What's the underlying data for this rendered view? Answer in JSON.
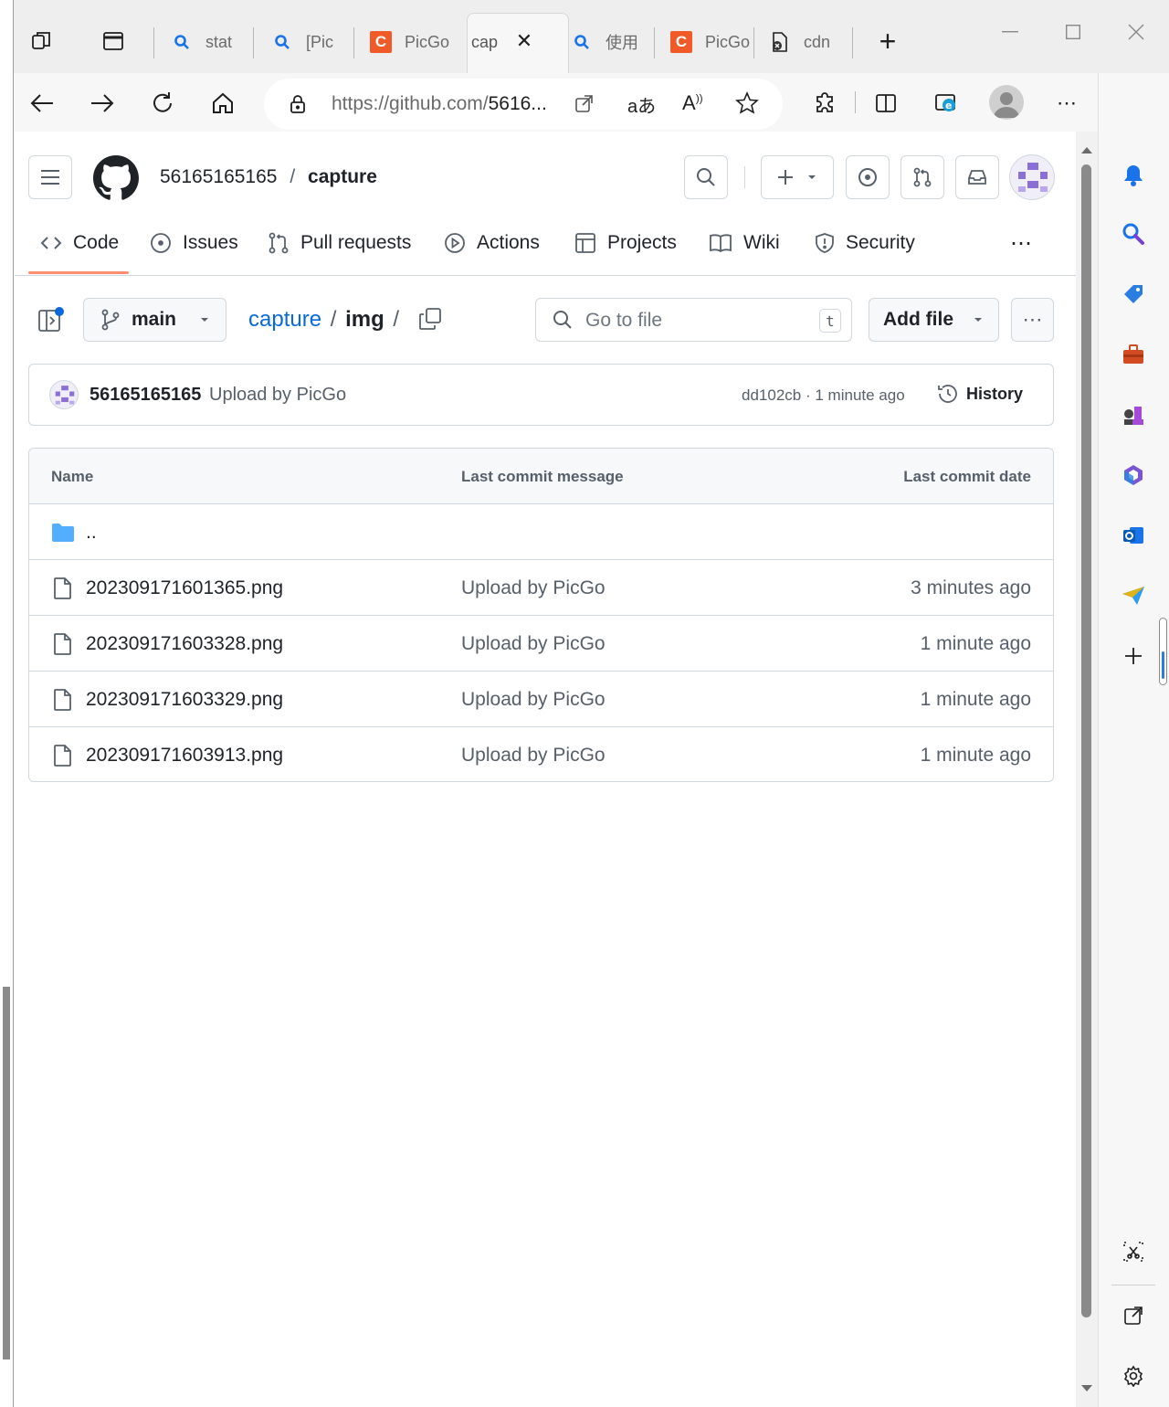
{
  "browser": {
    "tabs": [
      {
        "title": "stat",
        "icon": "search-icon"
      },
      {
        "title": "[Pic",
        "icon": "search-icon"
      },
      {
        "title": "PicGo",
        "icon": "csdn-icon"
      },
      {
        "title": "cap",
        "icon": "github-icon",
        "active": true
      },
      {
        "title": "使用",
        "icon": "search-icon"
      },
      {
        "title": "PicGo",
        "icon": "csdn-icon"
      },
      {
        "title": "cdn",
        "icon": "file-error-icon"
      }
    ],
    "url_host": "https://github.com/",
    "url_rest": "5616...",
    "close_tab_glyph": "✕",
    "new_tab_glyph": "+"
  },
  "github": {
    "owner": "56165165165",
    "separator": "/",
    "repo": "capture",
    "nav_tabs": [
      "Code",
      "Issues",
      "Pull requests",
      "Actions",
      "Projects",
      "Wiki",
      "Security"
    ],
    "branch": "main",
    "breadcrumb": {
      "repo": "capture",
      "sep1": "/",
      "folder": "img",
      "sep2": "/"
    },
    "search": {
      "placeholder": "Go to file",
      "shortcut": "t"
    },
    "add_file_label": "Add file",
    "commit": {
      "author": "56165165165",
      "message": "Upload by PicGo",
      "sha": "dd102cb",
      "dot": "·",
      "time": "1 minute ago",
      "history_label": "History"
    },
    "table": {
      "headers": {
        "name": "Name",
        "message": "Last commit message",
        "date": "Last commit date"
      },
      "parent_dir": "..",
      "files": [
        {
          "name": "202309171601365.png",
          "message": "Upload by PicGo",
          "date": "3 minutes ago"
        },
        {
          "name": "202309171603328.png",
          "message": "Upload by PicGo",
          "date": "1 minute ago"
        },
        {
          "name": "202309171603329.png",
          "message": "Upload by PicGo",
          "date": "1 minute ago"
        },
        {
          "name": "202309171603913.png",
          "message": "Upload by PicGo",
          "date": "1 minute ago"
        }
      ]
    }
  },
  "colors": {
    "link": "#0969da",
    "accent_underline": "#fd8c73",
    "folder": "#54aeff",
    "csdn": "#f05a28"
  }
}
